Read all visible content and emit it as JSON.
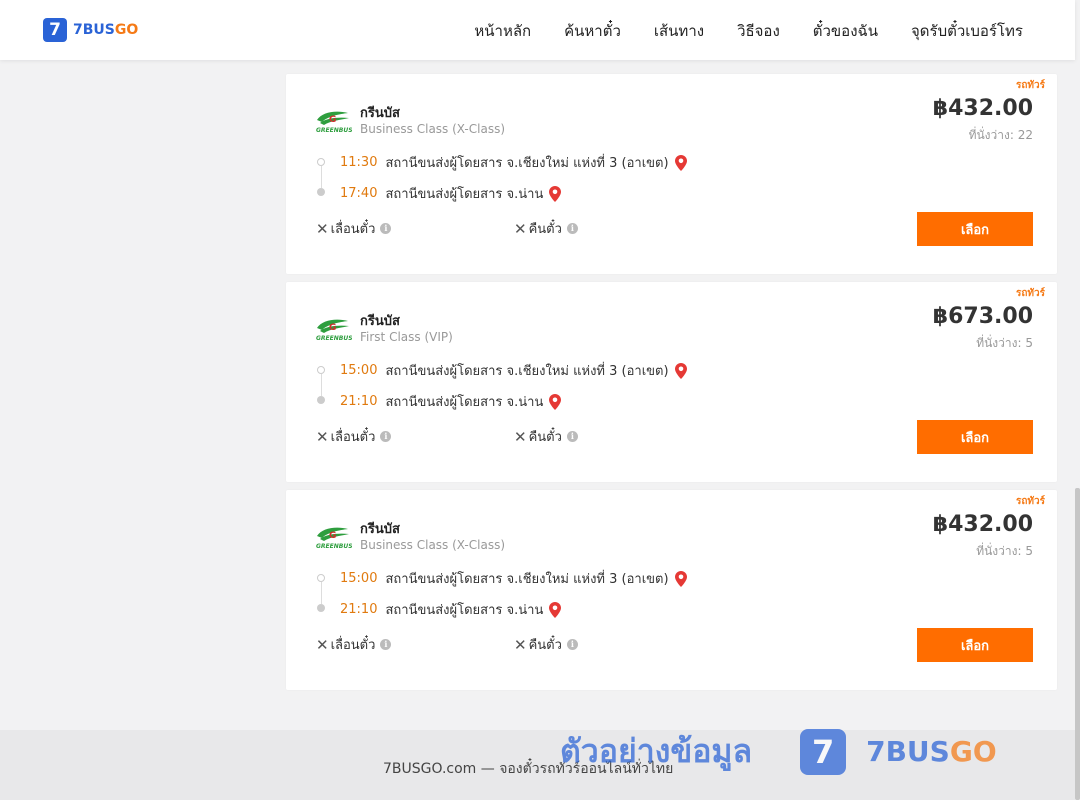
{
  "header": {
    "logo_number": "7",
    "logo_brand": "7BUS",
    "logo_brand_suffix": "GO",
    "nav": [
      "หน้าหลัก",
      "ค้นหาตั๋ว",
      "เส้นทาง",
      "วิธีจอง",
      "ตั๋วของฉัน",
      "จุดรับตั๋วเบอร์โทร"
    ]
  },
  "results": [
    {
      "badge": "รถทัวร์",
      "operator": "กรีนบัส",
      "bus_class": "Business Class (X-Class)",
      "price": "฿432.00",
      "seats": "ที่นั่งว่าง: 22",
      "depart_time": "11:30",
      "depart_station": "สถานีขนส่งผู้โดยสาร จ.เชียงใหม่ แห่งที่ 3 (อาเขต)",
      "arrive_time": "17:40",
      "arrive_station": "สถานีขนส่งผู้โดยสาร จ.น่าน",
      "reschedule": "เลื่อนตั๋ว",
      "refund": "คืนตั๋ว",
      "select": "เลือก"
    },
    {
      "badge": "รถทัวร์",
      "operator": "กรีนบัส",
      "bus_class": "First Class (VIP)",
      "price": "฿673.00",
      "seats": "ที่นั่งว่าง: 5",
      "depart_time": "15:00",
      "depart_station": "สถานีขนส่งผู้โดยสาร จ.เชียงใหม่ แห่งที่ 3 (อาเขต)",
      "arrive_time": "21:10",
      "arrive_station": "สถานีขนส่งผู้โดยสาร จ.น่าน",
      "reschedule": "เลื่อนตั๋ว",
      "refund": "คืนตั๋ว",
      "select": "เลือก"
    },
    {
      "badge": "รถทัวร์",
      "operator": "กรีนบัส",
      "bus_class": "Business Class (X-Class)",
      "price": "฿432.00",
      "seats": "ที่นั่งว่าง: 5",
      "depart_time": "15:00",
      "depart_station": "สถานีขนส่งผู้โดยสาร จ.เชียงใหม่ แห่งที่ 3 (อาเขต)",
      "arrive_time": "21:10",
      "arrive_station": "สถานีขนส่งผู้โดยสาร จ.น่าน",
      "reschedule": "เลื่อนตั๋ว",
      "refund": "คืนตั๋ว",
      "select": "เลือก"
    }
  ],
  "footer": {
    "text": "7BUSGO.com — จองตั๋วรถทัวร์ออนไลน์ทั่วไทย"
  },
  "watermark": {
    "text": "ตัวอย่างข้อมูล",
    "logo_number": "7",
    "brand": "7BUS",
    "brand_suffix": "GO"
  },
  "colors": {
    "brand_blue": "#2a63d6",
    "brand_orange": "#f57a16",
    "button_orange": "#ff6d00",
    "time_orange": "#e07a0f",
    "pin_red": "#e53935",
    "greenbus_green": "#2e9e3e"
  },
  "icons": {
    "pin": "map-pin-icon",
    "cross": "close-icon",
    "info": "info-icon",
    "operator_logo": "greenbus-logo"
  }
}
